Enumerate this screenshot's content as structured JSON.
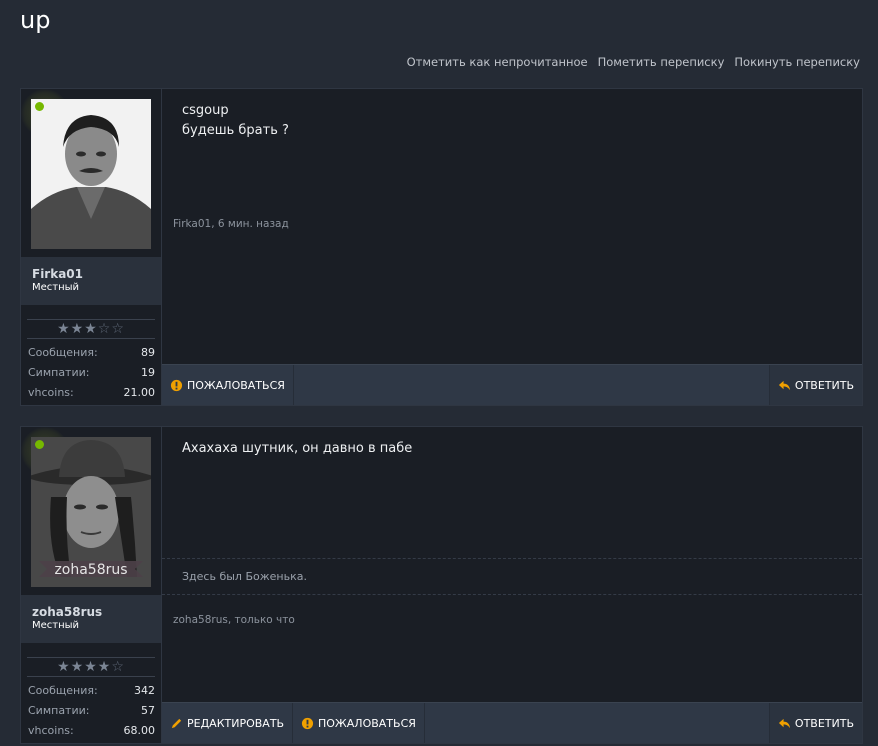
{
  "page": {
    "title": "up"
  },
  "topbar": {
    "mark_unread": "Отметить как непрочитанное",
    "mark_conv": "Пометить переписку",
    "leave_conv": "Покинуть переписку"
  },
  "stars_glyph": {
    "on": "★",
    "off": "☆"
  },
  "labels": {
    "messages": "Сообщения:",
    "likes": "Симпатии:",
    "coins": "vhcoins:"
  },
  "actions": {
    "report": "ПОЖАЛОВАТЬСЯ",
    "reply": "ОТВЕТИТЬ",
    "edit": "РЕДАКТИРОВАТЬ"
  },
  "messages": [
    {
      "username": "Firka01",
      "usertitle": "Местный",
      "rating": 3,
      "stats": {
        "messages": "89",
        "likes": "19",
        "coins": "21.00"
      },
      "lines": [
        "csgoup",
        "будешь брать ?"
      ],
      "meta": "Firka01, 6 мин. назад",
      "colors": {
        "online": "#76b800"
      }
    },
    {
      "username": "zoha58rus",
      "usertitle": "Местный",
      "rating": 4,
      "stats": {
        "messages": "342",
        "likes": "57",
        "coins": "68.00"
      },
      "lines": [
        "Ахахаха шутник, он давно в пабе"
      ],
      "signature": "Здесь был Боженька.",
      "avatar_caption": "zoha58rus",
      "meta": "zoha58rus, только что",
      "colors": {
        "online": "#76b800"
      }
    }
  ],
  "colors": {
    "report_icon": "#f0a000",
    "reply_icon": "#f0a000",
    "edit_icon": "#f0a000"
  }
}
